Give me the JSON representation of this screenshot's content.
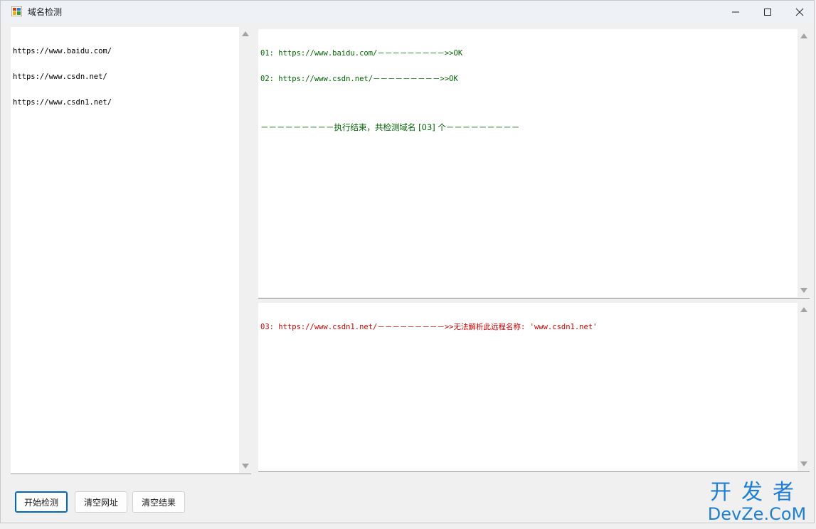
{
  "window": {
    "title": "域名检测",
    "controls": {
      "minimize": "minimize-icon",
      "maximize": "maximize-icon",
      "close": "close-icon"
    }
  },
  "urls_panel": {
    "lines": [
      "https://www.baidu.com/",
      "https://www.csdn.net/",
      "https://www.csdn1.net/"
    ]
  },
  "result_panel": {
    "lines": [
      "01: https://www.baidu.com/－－－－－－－－－>>OK",
      "02: https://www.csdn.net/－－－－－－－－－>>OK",
      "",
      "－－－－－－－－－执行结束，共检测域名 [03] 个－－－－－－－－－"
    ],
    "color": "#006400"
  },
  "error_panel": {
    "lines": [
      "03: https://www.csdn1.net/－－－－－－－－－>>无法解析此远程名称: 'www.csdn1.net'"
    ],
    "color": "#d00000"
  },
  "buttons": {
    "start": "开始检测",
    "clear_urls": "清空网址",
    "clear_results": "清空结果"
  },
  "watermark": {
    "top": "开发者",
    "bottom": "DevZe.CoM"
  }
}
